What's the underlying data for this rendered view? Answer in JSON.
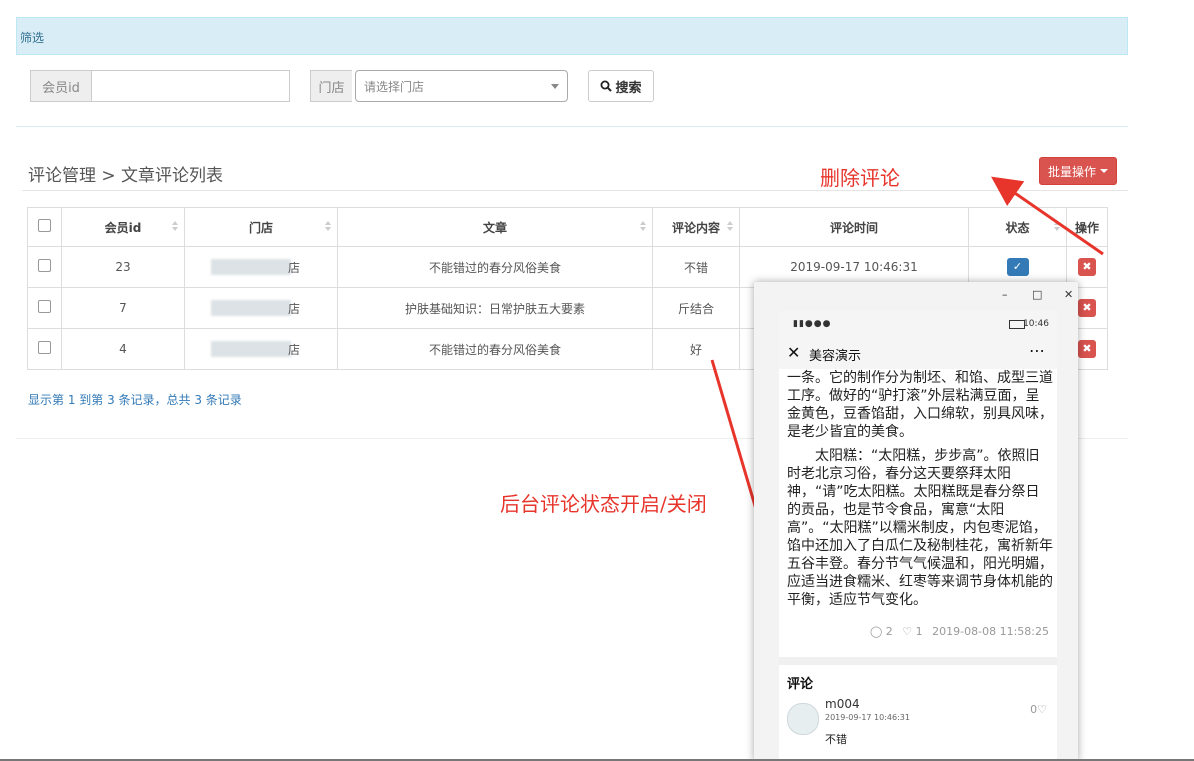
{
  "filter": {
    "title": "筛选",
    "member_label": "会员id",
    "member_value": "",
    "store_label": "门店",
    "store_placeholder": "请选择门店",
    "search_label": "搜索"
  },
  "page": {
    "title": "评论管理 > 文章评论列表",
    "batch_label": "批量操作"
  },
  "table": {
    "headers": [
      "会员id",
      "门店",
      "文章",
      "评论内容",
      "评论时间",
      "状态",
      "操作"
    ],
    "rows": [
      {
        "member_id": "23",
        "store": "店",
        "article": "不能错过的春分风俗美食",
        "content": "不错",
        "time": "2019-09-17 10:46:31"
      },
      {
        "member_id": "7",
        "store": "店",
        "article": "护肤基础知识：日常护肤五大要素",
        "content": "斤结合",
        "time": ""
      },
      {
        "member_id": "4",
        "store": "店",
        "article": "不能错过的春分风俗美食",
        "content": "好",
        "time": ""
      }
    ]
  },
  "records_text": "显示第 1 到第 3 条记录，总共 3 条记录",
  "annotations": {
    "delete": "删除评论",
    "status": "后台评论状态开启/关闭"
  },
  "phone": {
    "time": "10:46",
    "title": "美容演示",
    "article_cut": "一条。它的制作分为制坯、和馅、成型三道工序。做好的“驴打滚”外层粘满豆面，呈金黄色，豆香馅甜，入口绵软，别具风味，是老少皆宜的美食。",
    "article_p2": "太阳糕：“太阳糕，步步高”。依照旧时老北京习俗，春分这天要祭拜太阳神，“请”吃太阳糕。太阳糕既是春分祭日的贡品，也是节令食品，寓意“太阳高”。“太阳糕”以糯米制皮，内包枣泥馅，馅中还加入了白瓜仁及秘制桂花，寓祈新年五谷丰登。春分节气气候温和，阳光明媚，应适当进食糯米、红枣等来调节身体机能的平衡，适应节气变化。",
    "comments_count": "2",
    "likes_count": "1",
    "article_date": "2019-08-08 11:58:25",
    "comment_section": "评论",
    "commenter": "m004",
    "comment_time": "2019-09-17 10:46:31",
    "comment_likes": "0",
    "comment_text": "不错"
  },
  "colors": {
    "accent_red": "#d9534f",
    "annotation_red": "#e7352c",
    "primary_blue": "#337ab7",
    "filter_bg": "#d9edf7"
  }
}
